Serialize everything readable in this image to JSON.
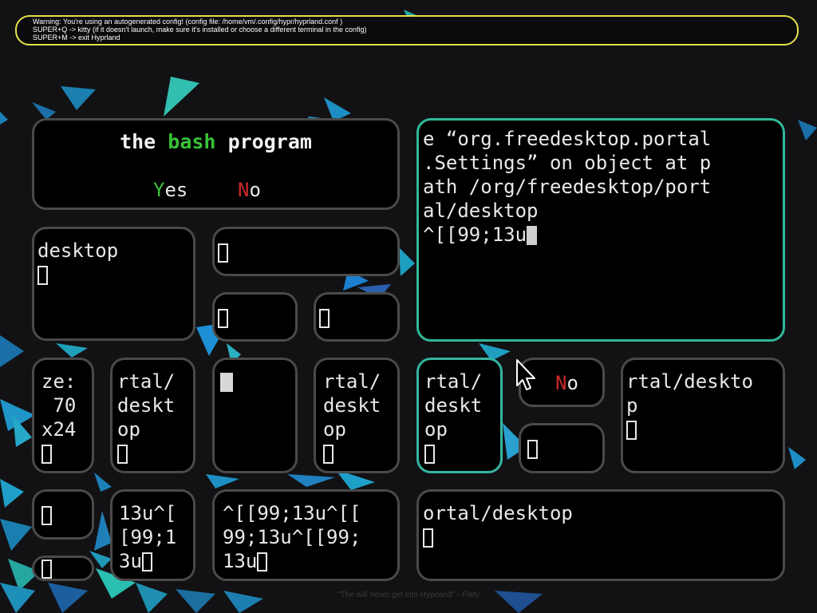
{
  "notification": {
    "line1": "Warning: You're using an autogenerated config! (config file: /home/vm/.config/hypr/hyprland.conf )",
    "line2": "SUPER+Q -> kitty (if it doesn't launch, make sure it's installed or choose a different terminal in the config)",
    "line3": "SUPER+M -> exit Hyprland"
  },
  "dialog": {
    "title_the": "the",
    "title_bash": "bash",
    "title_program": "program",
    "yes_hotkey": "Y",
    "yes_rest": "es",
    "no_hotkey": "N",
    "no_rest": "o"
  },
  "small_no": {
    "hotkey": "N",
    "rest": "o"
  },
  "terminals": {
    "focused": {
      "l1": "e “org.freedesktop.portal",
      "l2": ".Settings” on object at p",
      "l3": "ath /org/freedesktop/port",
      "l4": "al/desktop",
      "l5": "^[[99;13u"
    },
    "desktop": {
      "l1": "desktop"
    },
    "size": {
      "l1": "ze:",
      "l2": " 70",
      "l3": "x24"
    },
    "rtal_a": {
      "l1": "rtal/",
      "l2": "deskt",
      "l3": "op"
    },
    "rtal_b": {
      "l1": "rtal/",
      "l2": "deskt",
      "l3": "op"
    },
    "rtal_c": {
      "l1": "rtal/",
      "l2": "deskt",
      "l3": "op"
    },
    "rtal_wide": {
      "l1": "rtal/deskto",
      "l2": "p"
    },
    "seq_a": {
      "l1": "13u^[",
      "l2": "[99;1",
      "l3": "3u"
    },
    "seq_b": {
      "l1": "^[[99;13u^[[",
      "l2": "99;13u^[[99;",
      "l3": "13u"
    },
    "ortal": {
      "l1": "ortal/desktop"
    }
  },
  "footer_caption": "\"The will never get into Hyprland\" - Flafy",
  "colors": {
    "active_border": "#2fb99a",
    "inactive_border": "#4a4a4a",
    "notification_border": "#e6e04a",
    "wallpaper_shards": "#1f8fb8"
  }
}
